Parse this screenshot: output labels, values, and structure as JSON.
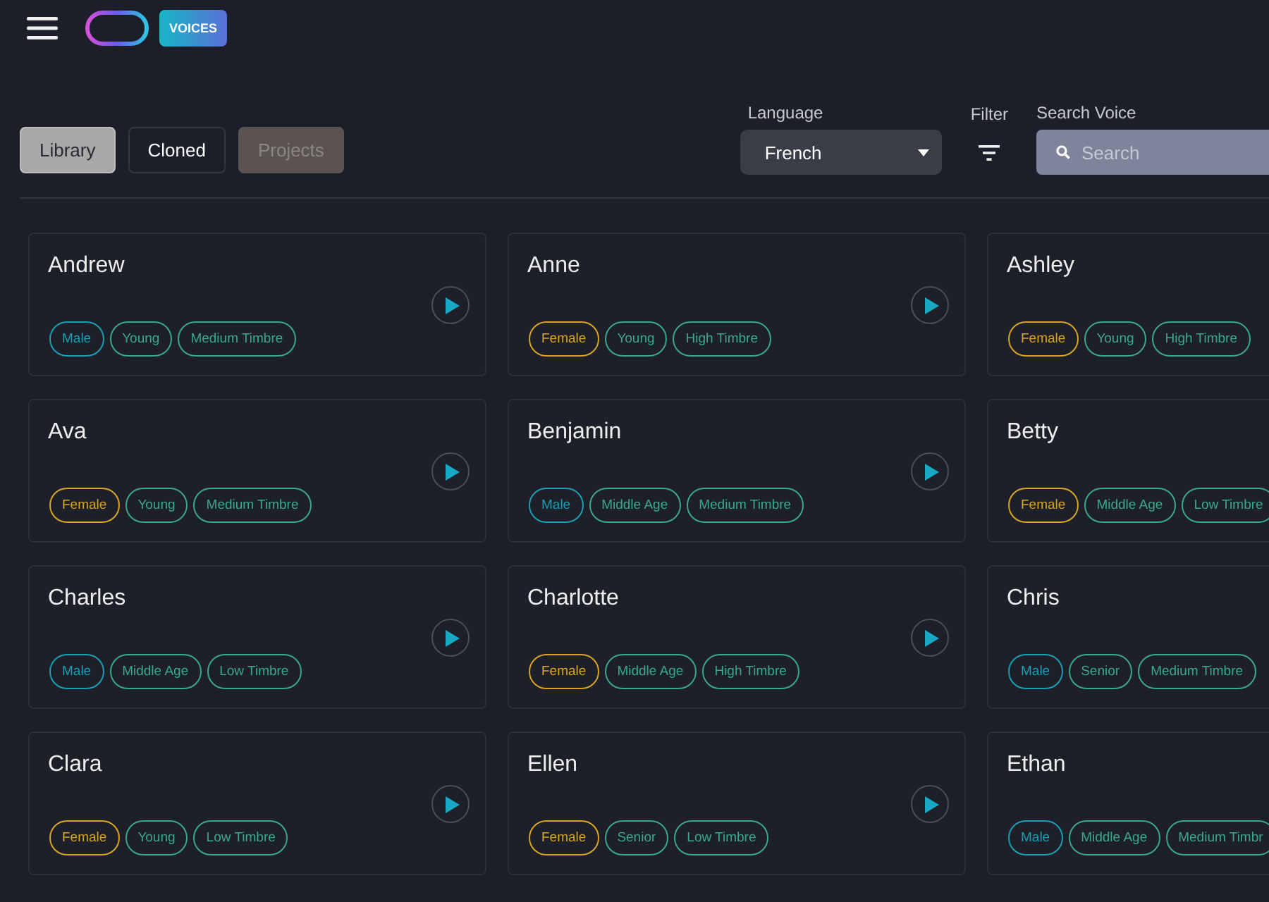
{
  "header": {
    "badge": "VOICES"
  },
  "tabs": [
    {
      "label": "Library",
      "selected": true,
      "disabled": false
    },
    {
      "label": "Cloned",
      "selected": false,
      "disabled": false
    },
    {
      "label": "Projects",
      "selected": false,
      "disabled": true
    }
  ],
  "language": {
    "label": "Language",
    "value": "French"
  },
  "filter": {
    "label": "Filter"
  },
  "search": {
    "label": "Search Voice",
    "placeholder": "Search"
  },
  "voices": [
    {
      "name": "Andrew",
      "play_visible": true,
      "tags": [
        {
          "label": "Male",
          "color": "#1a9fb5"
        },
        {
          "label": "Young",
          "color": "#3aa88a"
        },
        {
          "label": "Medium Timbre",
          "color": "#3aa88a"
        }
      ]
    },
    {
      "name": "Anne",
      "play_visible": true,
      "tags": [
        {
          "label": "Female",
          "color": "#d9a520"
        },
        {
          "label": "Young",
          "color": "#3aa88a"
        },
        {
          "label": "High Timbre",
          "color": "#3aa88a"
        }
      ]
    },
    {
      "name": "Ashley",
      "play_visible": false,
      "tags": [
        {
          "label": "Female",
          "color": "#d9a520"
        },
        {
          "label": "Young",
          "color": "#3aa88a"
        },
        {
          "label": "High Timbre",
          "color": "#3aa88a"
        }
      ]
    },
    {
      "name": "Ava",
      "play_visible": true,
      "tags": [
        {
          "label": "Female",
          "color": "#d9a520"
        },
        {
          "label": "Young",
          "color": "#3aa88a"
        },
        {
          "label": "Medium Timbre",
          "color": "#3aa88a"
        }
      ]
    },
    {
      "name": "Benjamin",
      "play_visible": true,
      "tags": [
        {
          "label": "Male",
          "color": "#1a9fb5"
        },
        {
          "label": "Middle Age",
          "color": "#3aa88a"
        },
        {
          "label": "Medium Timbre",
          "color": "#3aa88a"
        }
      ]
    },
    {
      "name": "Betty",
      "play_visible": false,
      "tags": [
        {
          "label": "Female",
          "color": "#d9a520"
        },
        {
          "label": "Middle Age",
          "color": "#3aa88a"
        },
        {
          "label": "Low Timbre",
          "color": "#3aa88a"
        }
      ]
    },
    {
      "name": "Charles",
      "play_visible": true,
      "tags": [
        {
          "label": "Male",
          "color": "#1a9fb5"
        },
        {
          "label": "Middle Age",
          "color": "#3aa88a"
        },
        {
          "label": "Low Timbre",
          "color": "#3aa88a"
        }
      ]
    },
    {
      "name": "Charlotte",
      "play_visible": true,
      "tags": [
        {
          "label": "Female",
          "color": "#d9a520"
        },
        {
          "label": "Middle Age",
          "color": "#3aa88a"
        },
        {
          "label": "High Timbre",
          "color": "#3aa88a"
        }
      ]
    },
    {
      "name": "Chris",
      "play_visible": false,
      "tags": [
        {
          "label": "Male",
          "color": "#1a9fb5"
        },
        {
          "label": "Senior",
          "color": "#3aa88a"
        },
        {
          "label": "Medium Timbre",
          "color": "#3aa88a"
        }
      ]
    },
    {
      "name": "Clara",
      "play_visible": true,
      "tags": [
        {
          "label": "Female",
          "color": "#d9a520"
        },
        {
          "label": "Young",
          "color": "#3aa88a"
        },
        {
          "label": "Low Timbre",
          "color": "#3aa88a"
        }
      ]
    },
    {
      "name": "Ellen",
      "play_visible": true,
      "tags": [
        {
          "label": "Female",
          "color": "#d9a520"
        },
        {
          "label": "Senior",
          "color": "#3aa88a"
        },
        {
          "label": "Low Timbre",
          "color": "#3aa88a"
        }
      ]
    },
    {
      "name": "Ethan",
      "play_visible": false,
      "tags": [
        {
          "label": "Male",
          "color": "#1a9fb5"
        },
        {
          "label": "Middle Age",
          "color": "#3aa88a"
        },
        {
          "label": "Medium Timbr",
          "color": "#3aa88a"
        }
      ]
    }
  ]
}
